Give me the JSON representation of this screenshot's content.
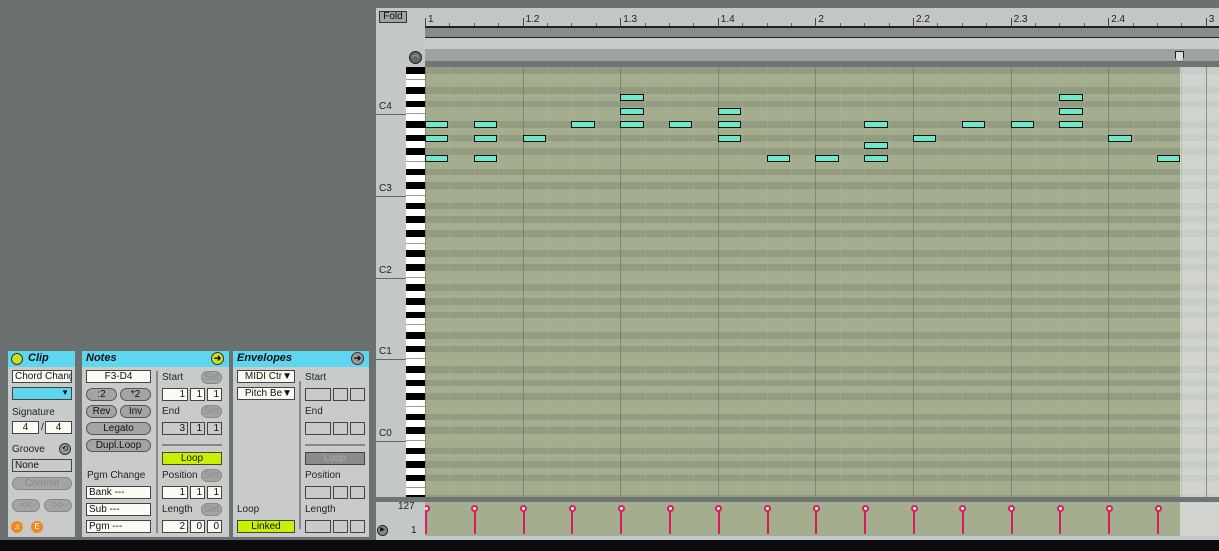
{
  "clip": {
    "title": "Clip",
    "name": "Chord Chang",
    "signature_label": "Signature",
    "sig_num": "4",
    "sig_den": "4",
    "groove_label": "Groove",
    "groove_value": "None",
    "commit": "Commit",
    "prev": "<<",
    "next": ">>",
    "color": "#5fd6f0"
  },
  "notes_panel": {
    "title": "Notes",
    "range": "F3-D4",
    "div2": ":2",
    "mul2": "*2",
    "rev": "Rev",
    "inv": "Inv",
    "legato": "Legato",
    "dupl": "Dupl.Loop",
    "pgm_label": "Pgm Change",
    "bank": "Bank ---",
    "sub": "Sub ---",
    "pgm": "Pgm ---",
    "start_label": "Start",
    "start": [
      "1",
      "1",
      "1"
    ],
    "end_label": "End",
    "end": [
      "3",
      "1",
      "1"
    ],
    "loop": "Loop",
    "position_label": "Position",
    "position": [
      "1",
      "1",
      "1"
    ],
    "length_label": "Length",
    "length": [
      "2",
      "0",
      "0"
    ],
    "set": "Set"
  },
  "envelopes": {
    "title": "Envelopes",
    "control": "MIDI Ctr",
    "param": "Pitch Be",
    "start_label": "Start",
    "end_label": "End",
    "loop": "Loop",
    "position_label": "Position",
    "length_label": "Length",
    "loop_label": "Loop",
    "linked": "Linked"
  },
  "editor": {
    "fold": "Fold",
    "ruler": [
      "1",
      "1.2",
      "1.3",
      "1.4",
      "2",
      "2.2",
      "2.3",
      "2.4",
      "3"
    ],
    "octaves": [
      "C4",
      "C3",
      "C2",
      "C1",
      "C0"
    ],
    "vel_max": "127",
    "vel_min": "1",
    "note_color": "#6de8c8",
    "velocity_color": "#d81c5c",
    "notes": [
      {
        "pitch": "A#3",
        "start": 0,
        "length": 0.25,
        "velocity": 127
      },
      {
        "pitch": "G#3",
        "start": 0,
        "length": 0.25,
        "velocity": 127
      },
      {
        "pitch": "F3",
        "start": 0,
        "length": 0.25,
        "velocity": 127
      },
      {
        "pitch": "A#3",
        "start": 0.5,
        "length": 0.25,
        "velocity": 127
      },
      {
        "pitch": "G#3",
        "start": 0.5,
        "length": 0.25,
        "velocity": 127
      },
      {
        "pitch": "F3",
        "start": 0.5,
        "length": 0.25,
        "velocity": 127
      },
      {
        "pitch": "G#3",
        "start": 1,
        "length": 0.25,
        "velocity": 127
      },
      {
        "pitch": "A#3",
        "start": 1.5,
        "length": 0.25,
        "velocity": 127
      },
      {
        "pitch": "D4",
        "start": 2,
        "length": 0.25,
        "velocity": 127
      },
      {
        "pitch": "C4",
        "start": 2,
        "length": 0.25,
        "velocity": 127
      },
      {
        "pitch": "A#3",
        "start": 2,
        "length": 0.25,
        "velocity": 127
      },
      {
        "pitch": "A#3",
        "start": 2.5,
        "length": 0.25,
        "velocity": 127
      },
      {
        "pitch": "C4",
        "start": 3,
        "length": 0.25,
        "velocity": 127
      },
      {
        "pitch": "A#3",
        "start": 3,
        "length": 0.25,
        "velocity": 127
      },
      {
        "pitch": "G#3",
        "start": 3,
        "length": 0.25,
        "velocity": 127
      },
      {
        "pitch": "F3",
        "start": 3.5,
        "length": 0.25,
        "velocity": 127
      },
      {
        "pitch": "F3",
        "start": 4,
        "length": 0.25,
        "velocity": 127
      },
      {
        "pitch": "A#3",
        "start": 4.5,
        "length": 0.25,
        "velocity": 127
      },
      {
        "pitch": "G3",
        "start": 4.5,
        "length": 0.25,
        "velocity": 127
      },
      {
        "pitch": "F3",
        "start": 4.5,
        "length": 0.25,
        "velocity": 127
      },
      {
        "pitch": "G#3",
        "start": 5,
        "length": 0.25,
        "velocity": 127
      },
      {
        "pitch": "A#3",
        "start": 5.5,
        "length": 0.25,
        "velocity": 127
      },
      {
        "pitch": "A#3",
        "start": 6,
        "length": 0.25,
        "velocity": 127
      },
      {
        "pitch": "D4",
        "start": 6.5,
        "length": 0.25,
        "velocity": 127
      },
      {
        "pitch": "C4",
        "start": 6.5,
        "length": 0.25,
        "velocity": 127
      },
      {
        "pitch": "A#3",
        "start": 6.5,
        "length": 0.25,
        "velocity": 127
      },
      {
        "pitch": "G#3",
        "start": 7,
        "length": 0.25,
        "velocity": 127
      },
      {
        "pitch": "F3",
        "start": 7.5,
        "length": 0.25,
        "velocity": 127
      }
    ]
  }
}
